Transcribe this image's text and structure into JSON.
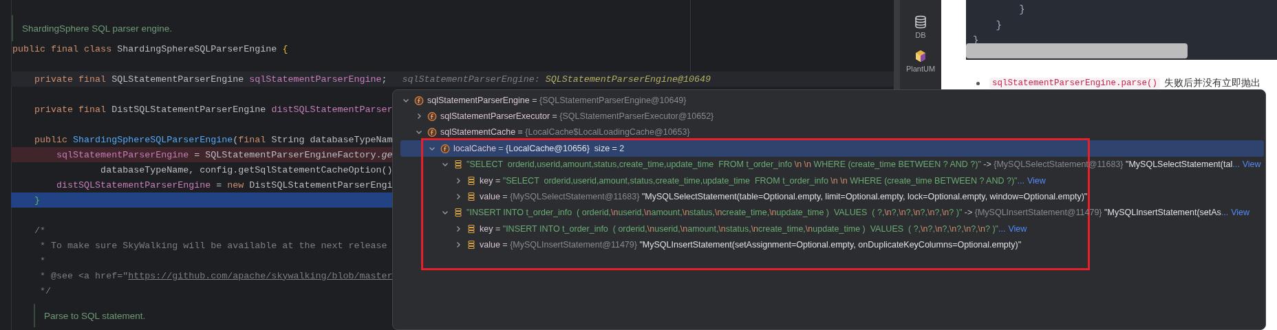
{
  "editor": {
    "lines": [
      {
        "kind": "doc",
        "text": "ShardingSphere SQL parser engine."
      },
      {
        "kind": "code",
        "tokens": [
          {
            "kind": "keyword",
            "text": "public final class "
          },
          {
            "kind": "plain",
            "text": "ShardingSphereSQLParserEngine "
          },
          {
            "kind": "brace",
            "text": "{"
          }
        ]
      },
      {
        "kind": "blank"
      },
      {
        "kind": "caret_line",
        "tokens": [
          {
            "kind": "keyword",
            "text": "    private final "
          },
          {
            "kind": "plain",
            "text": "SQLStatementParserEngine "
          },
          {
            "kind": "field",
            "text": "sqlStatementParserEngine"
          },
          {
            "kind": "plain",
            "text": ";"
          }
        ],
        "inline_value": {
          "name": "sqlStatementParserEngine:",
          "value": "SQLStatementParserEngine@10649"
        }
      },
      {
        "kind": "blank"
      },
      {
        "kind": "code",
        "tokens": [
          {
            "kind": "keyword",
            "text": "    private final "
          },
          {
            "kind": "plain",
            "text": "DistSQLStatementParserEngine "
          },
          {
            "kind": "field",
            "text": "distSQLStatementParser"
          }
        ]
      },
      {
        "kind": "blank"
      },
      {
        "kind": "code",
        "tokens": [
          {
            "kind": "keyword",
            "text": "    public "
          },
          {
            "kind": "method",
            "text": "ShardingSphereSQLParserEngine"
          },
          {
            "kind": "plain",
            "text": "("
          },
          {
            "kind": "keyword",
            "text": "final "
          },
          {
            "kind": "plain",
            "text": "String databaseTypeNam"
          }
        ]
      },
      {
        "kind": "breakpoint_line",
        "tokens": [
          {
            "kind": "field",
            "text": "        sqlStatementParserEngine"
          },
          {
            "kind": "plain",
            "text": " = SQLStatementParserEngineFactory."
          },
          {
            "kind": "static",
            "text": "ge"
          }
        ]
      },
      {
        "kind": "code",
        "tokens": [
          {
            "kind": "plain",
            "text": "                databaseTypeName, config.getSqlStatementCacheOption()"
          }
        ]
      },
      {
        "kind": "code",
        "tokens": [
          {
            "kind": "field",
            "text": "        distSQLStatementParserEngine"
          },
          {
            "kind": "plain",
            "text": " = "
          },
          {
            "kind": "keyword",
            "text": "new "
          },
          {
            "kind": "plain",
            "text": "DistSQLStatementParserEngi"
          }
        ]
      },
      {
        "kind": "execution_line",
        "tokens": [
          {
            "kind": "match",
            "text": "    }"
          }
        ]
      },
      {
        "kind": "blank"
      },
      {
        "kind": "code",
        "tokens": [
          {
            "kind": "comment",
            "text": "    /*"
          }
        ]
      },
      {
        "kind": "code",
        "tokens": [
          {
            "kind": "comment",
            "text": "     * To make sure SkyWalking will be available at the next release"
          }
        ]
      },
      {
        "kind": "code",
        "tokens": [
          {
            "kind": "comment",
            "text": "     *"
          }
        ]
      },
      {
        "kind": "code",
        "tokens": [
          {
            "kind": "comment",
            "text": "     * @see <a href=\""
          },
          {
            "kind": "url",
            "text": "https://github.com/apache/skywalking/blob/master"
          }
        ]
      },
      {
        "kind": "code",
        "tokens": [
          {
            "kind": "comment",
            "text": "     */"
          }
        ]
      },
      {
        "kind": "member_doc",
        "text": "Parse to SQL statement."
      }
    ]
  },
  "tool_strip": {
    "items": [
      {
        "kind": "database",
        "label": "DB"
      },
      {
        "kind": "plantuml",
        "label": "PlantUM"
      }
    ]
  },
  "web_page": {
    "code_block": {
      "lines": [
        "        }",
        "    }",
        "}"
      ]
    },
    "bullet": {
      "code": "sqlStatementParserEngine.parse()",
      "text": "失败后并没有立即抛出"
    }
  },
  "popup": {
    "tree": [
      {
        "kind": "field",
        "expanded": true,
        "selected": false,
        "parts": [
          {
            "kind": "name",
            "text": "sqlStatementParserEngine"
          },
          {
            "kind": "op",
            "text": " = "
          },
          {
            "kind": "type",
            "text": "{SQLStatementParserEngine@10649}"
          }
        ],
        "children": [
          {
            "kind": "field",
            "expanded": false,
            "selected": false,
            "parts": [
              {
                "kind": "name",
                "text": "sqlStatementParserExecutor"
              },
              {
                "kind": "op",
                "text": " = "
              },
              {
                "kind": "type",
                "text": "{SQLStatementParserExecutor@10652}"
              }
            ]
          },
          {
            "kind": "field",
            "expanded": true,
            "selected": false,
            "parts": [
              {
                "kind": "name",
                "text": "sqlStatementCache"
              },
              {
                "kind": "op",
                "text": " = "
              },
              {
                "kind": "type",
                "text": "{LocalCache$LocalLoadingCache@10653}"
              }
            ],
            "children": [
              {
                "kind": "field",
                "expanded": true,
                "selected": true,
                "parts": [
                  {
                    "kind": "name",
                    "text": "localCache"
                  },
                  {
                    "kind": "op",
                    "text": " = "
                  },
                  {
                    "kind": "value",
                    "text": "{LocalCache@10656}  size = 2"
                  }
                ],
                "children": [
                  {
                    "kind": "entry",
                    "expanded": true,
                    "selected": false,
                    "parts": [
                      {
                        "kind": "string",
                        "text": "\"SELECT  orderid,userid,amount,status,create_time,update_time  FROM t_order_info "
                      },
                      {
                        "kind": "escape",
                        "text": "\\n \\n"
                      },
                      {
                        "kind": "string",
                        "text": " WHERE (create_time BETWEEN ? AND ?)\""
                      },
                      {
                        "kind": "op",
                        "text": " -> "
                      },
                      {
                        "kind": "type",
                        "text": "{MySQLSelectStatement@11683}"
                      },
                      {
                        "kind": "value",
                        "text": " \"MySQLSelectStatement(tal"
                      },
                      {
                        "kind": "more",
                        "text": "..."
                      },
                      {
                        "kind": "link",
                        "text": "View"
                      }
                    ],
                    "children": [
                      {
                        "kind": "entry",
                        "expanded": false,
                        "selected": false,
                        "parts": [
                          {
                            "kind": "name",
                            "text": "key"
                          },
                          {
                            "kind": "op",
                            "text": " = "
                          },
                          {
                            "kind": "string",
                            "text": "\"SELECT  orderid,userid,amount,status,create_time,update_time  FROM t_order_info "
                          },
                          {
                            "kind": "escape",
                            "text": "\\n \\n"
                          },
                          {
                            "kind": "string",
                            "text": " WHERE (create_time BETWEEN ? AND ?)\""
                          },
                          {
                            "kind": "more",
                            "text": "..."
                          },
                          {
                            "kind": "link",
                            "text": "View"
                          }
                        ]
                      },
                      {
                        "kind": "entry",
                        "expanded": false,
                        "selected": false,
                        "parts": [
                          {
                            "kind": "name",
                            "text": "value"
                          },
                          {
                            "kind": "op",
                            "text": " = "
                          },
                          {
                            "kind": "type",
                            "text": "{MySQLSelectStatement@11683}"
                          },
                          {
                            "kind": "value",
                            "text": " \"MySQLSelectStatement(table=Optional.empty, limit=Optional.empty, lock=Optional.empty, window=Optional.empty)\""
                          }
                        ]
                      }
                    ]
                  },
                  {
                    "kind": "entry",
                    "expanded": true,
                    "selected": false,
                    "parts": [
                      {
                        "kind": "string",
                        "text": "\"INSERT INTO t_order_info  ( orderid,"
                      },
                      {
                        "kind": "escape",
                        "text": "\\n"
                      },
                      {
                        "kind": "string",
                        "text": "userid,"
                      },
                      {
                        "kind": "escape",
                        "text": "\\n"
                      },
                      {
                        "kind": "string",
                        "text": "amount,"
                      },
                      {
                        "kind": "escape",
                        "text": "\\n"
                      },
                      {
                        "kind": "string",
                        "text": "status,"
                      },
                      {
                        "kind": "escape",
                        "text": "\\n"
                      },
                      {
                        "kind": "string",
                        "text": "create_time,"
                      },
                      {
                        "kind": "escape",
                        "text": "\\n"
                      },
                      {
                        "kind": "string",
                        "text": "update_time )  VALUES  ( ?,"
                      },
                      {
                        "kind": "escape",
                        "text": "\\n"
                      },
                      {
                        "kind": "string",
                        "text": "?,"
                      },
                      {
                        "kind": "escape",
                        "text": "\\n"
                      },
                      {
                        "kind": "string",
                        "text": "?,"
                      },
                      {
                        "kind": "escape",
                        "text": "\\n"
                      },
                      {
                        "kind": "string",
                        "text": "?,"
                      },
                      {
                        "kind": "escape",
                        "text": "\\n"
                      },
                      {
                        "kind": "string",
                        "text": "?,"
                      },
                      {
                        "kind": "escape",
                        "text": "\\n"
                      },
                      {
                        "kind": "string",
                        "text": "? )\""
                      },
                      {
                        "kind": "op",
                        "text": " -> "
                      },
                      {
                        "kind": "type",
                        "text": "{MySQLInsertStatement@11479}"
                      },
                      {
                        "kind": "value",
                        "text": " \"MySQLInsertStatement(setAs"
                      },
                      {
                        "kind": "more",
                        "text": "..."
                      },
                      {
                        "kind": "link",
                        "text": "View"
                      }
                    ],
                    "children": [
                      {
                        "kind": "entry",
                        "expanded": false,
                        "selected": false,
                        "parts": [
                          {
                            "kind": "name",
                            "text": "key"
                          },
                          {
                            "kind": "op",
                            "text": " = "
                          },
                          {
                            "kind": "string",
                            "text": "\"INSERT INTO t_order_info  ( orderid,"
                          },
                          {
                            "kind": "escape",
                            "text": "\\n"
                          },
                          {
                            "kind": "string",
                            "text": "userid,"
                          },
                          {
                            "kind": "escape",
                            "text": "\\n"
                          },
                          {
                            "kind": "string",
                            "text": "amount,"
                          },
                          {
                            "kind": "escape",
                            "text": "\\n"
                          },
                          {
                            "kind": "string",
                            "text": "status,"
                          },
                          {
                            "kind": "escape",
                            "text": "\\n"
                          },
                          {
                            "kind": "string",
                            "text": "create_time,"
                          },
                          {
                            "kind": "escape",
                            "text": "\\n"
                          },
                          {
                            "kind": "string",
                            "text": "update_time )  VALUES  ( ?,"
                          },
                          {
                            "kind": "escape",
                            "text": "\\n"
                          },
                          {
                            "kind": "string",
                            "text": "?,"
                          },
                          {
                            "kind": "escape",
                            "text": "\\n"
                          },
                          {
                            "kind": "string",
                            "text": "?,"
                          },
                          {
                            "kind": "escape",
                            "text": "\\n"
                          },
                          {
                            "kind": "string",
                            "text": "?,"
                          },
                          {
                            "kind": "escape",
                            "text": "\\n"
                          },
                          {
                            "kind": "string",
                            "text": "?,"
                          },
                          {
                            "kind": "escape",
                            "text": "\\n"
                          },
                          {
                            "kind": "string",
                            "text": "? )\""
                          },
                          {
                            "kind": "more",
                            "text": "..."
                          },
                          {
                            "kind": "link",
                            "text": "View"
                          }
                        ]
                      },
                      {
                        "kind": "entry",
                        "expanded": false,
                        "selected": false,
                        "parts": [
                          {
                            "kind": "name",
                            "text": "value"
                          },
                          {
                            "kind": "op",
                            "text": " = "
                          },
                          {
                            "kind": "type",
                            "text": "{MySQLInsertStatement@11479}"
                          },
                          {
                            "kind": "value",
                            "text": " \"MySQLInsertStatement(setAssignment=Optional.empty, onDuplicateKeyColumns=Optional.empty)\""
                          }
                        ]
                      }
                    ]
                  }
                ]
              }
            ]
          }
        ]
      }
    ]
  }
}
